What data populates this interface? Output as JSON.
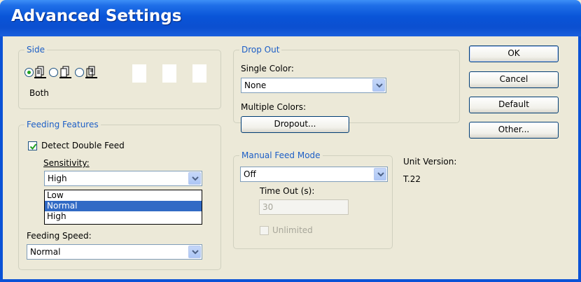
{
  "window": {
    "title": "Advanced Settings"
  },
  "side": {
    "title": "Side",
    "mnemonic": "e",
    "selected_label": "Both",
    "options": [
      "both",
      "front",
      "back"
    ]
  },
  "drop_out": {
    "title": "Drop Out",
    "single_color_label": "Single Color:",
    "single_color_value": "None",
    "multiple_colors_label": "Multiple Colors:",
    "dropout_button": "Dropout..."
  },
  "feeding_features": {
    "title": "Feeding Features",
    "detect_double_feed_label": "Detect Double Feed",
    "detect_double_feed_checked": true,
    "sensitivity_label": "Sensitivity:",
    "sensitivity_value": "High",
    "sensitivity_options": [
      "Low",
      "Normal",
      "High"
    ],
    "sensitivity_highlighted": "Normal",
    "feeding_speed_label": "Feeding Speed:",
    "feeding_speed_value": "Normal"
  },
  "manual_feed": {
    "title": "Manual Feed Mode",
    "mode_value": "Off",
    "timeout_label": "Time Out (s):",
    "timeout_value": "30",
    "unlimited_label": "Unlimited"
  },
  "unit": {
    "label": "Unit Version:",
    "value": "T.22"
  },
  "buttons": {
    "ok": "OK",
    "cancel": "Cancel",
    "default": "Default",
    "other": "Other..."
  },
  "colors": {
    "title_bar": "#0b52d6",
    "group_title": "#1c5ec6",
    "highlight": "#316ac5",
    "dialog_bg": "#ece9d8"
  }
}
